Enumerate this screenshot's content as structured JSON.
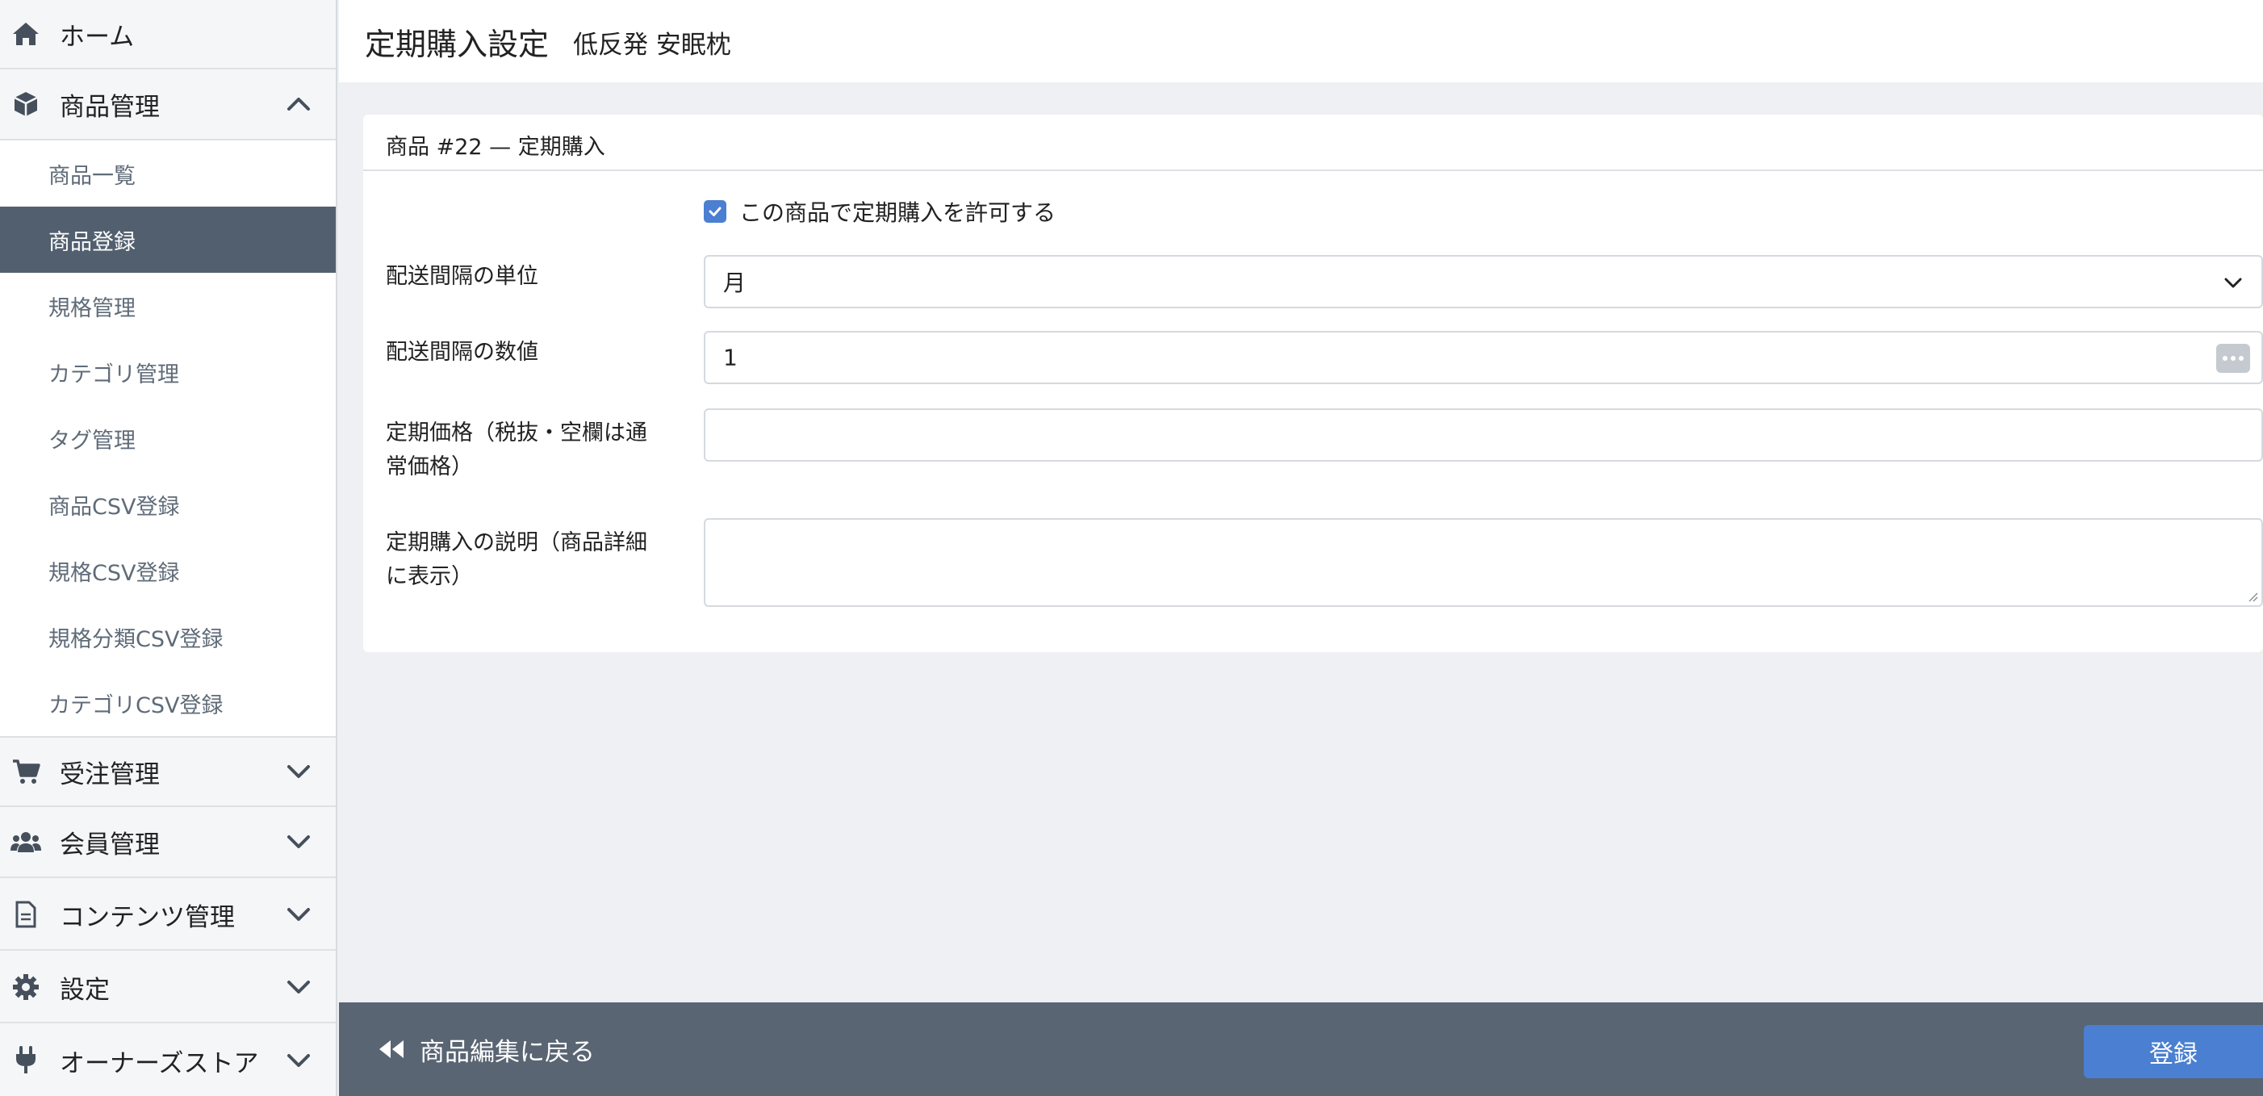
{
  "sidebar": {
    "home": "ホーム",
    "product_mgmt": "商品管理",
    "items": [
      {
        "label": "商品一覧"
      },
      {
        "label": "商品登録"
      },
      {
        "label": "規格管理"
      },
      {
        "label": "カテゴリ管理"
      },
      {
        "label": "タグ管理"
      },
      {
        "label": "商品CSV登録"
      },
      {
        "label": "規格CSV登録"
      },
      {
        "label": "規格分類CSV登録"
      },
      {
        "label": "カテゴリCSV登録"
      }
    ],
    "order_mgmt": "受注管理",
    "member_mgmt": "会員管理",
    "content_mgmt": "コンテンツ管理",
    "settings": "設定",
    "owners_store": "オーナーズストア"
  },
  "header": {
    "title": "定期購入設定",
    "subtitle": "低反発 安眠枕"
  },
  "card": {
    "title": "商品 #22 — 定期購入",
    "allow_label": "この商品で定期購入を許可する",
    "interval_unit_label": "配送間隔の単位",
    "interval_unit_value": "月",
    "interval_value_label": "配送間隔の数値",
    "interval_value": "1",
    "price_label_1": "定期価格（税抜・空欄は通",
    "price_label_2": "常価格）",
    "desc_label_1": "定期購入の説明（商品詳細",
    "desc_label_2": "に表示）"
  },
  "footer": {
    "back": "商品編集に戻る",
    "submit": "登録"
  },
  "colors": {
    "accent": "#4a7fd1",
    "sidebar_active": "#525f6f",
    "footer": "#5a6573"
  }
}
